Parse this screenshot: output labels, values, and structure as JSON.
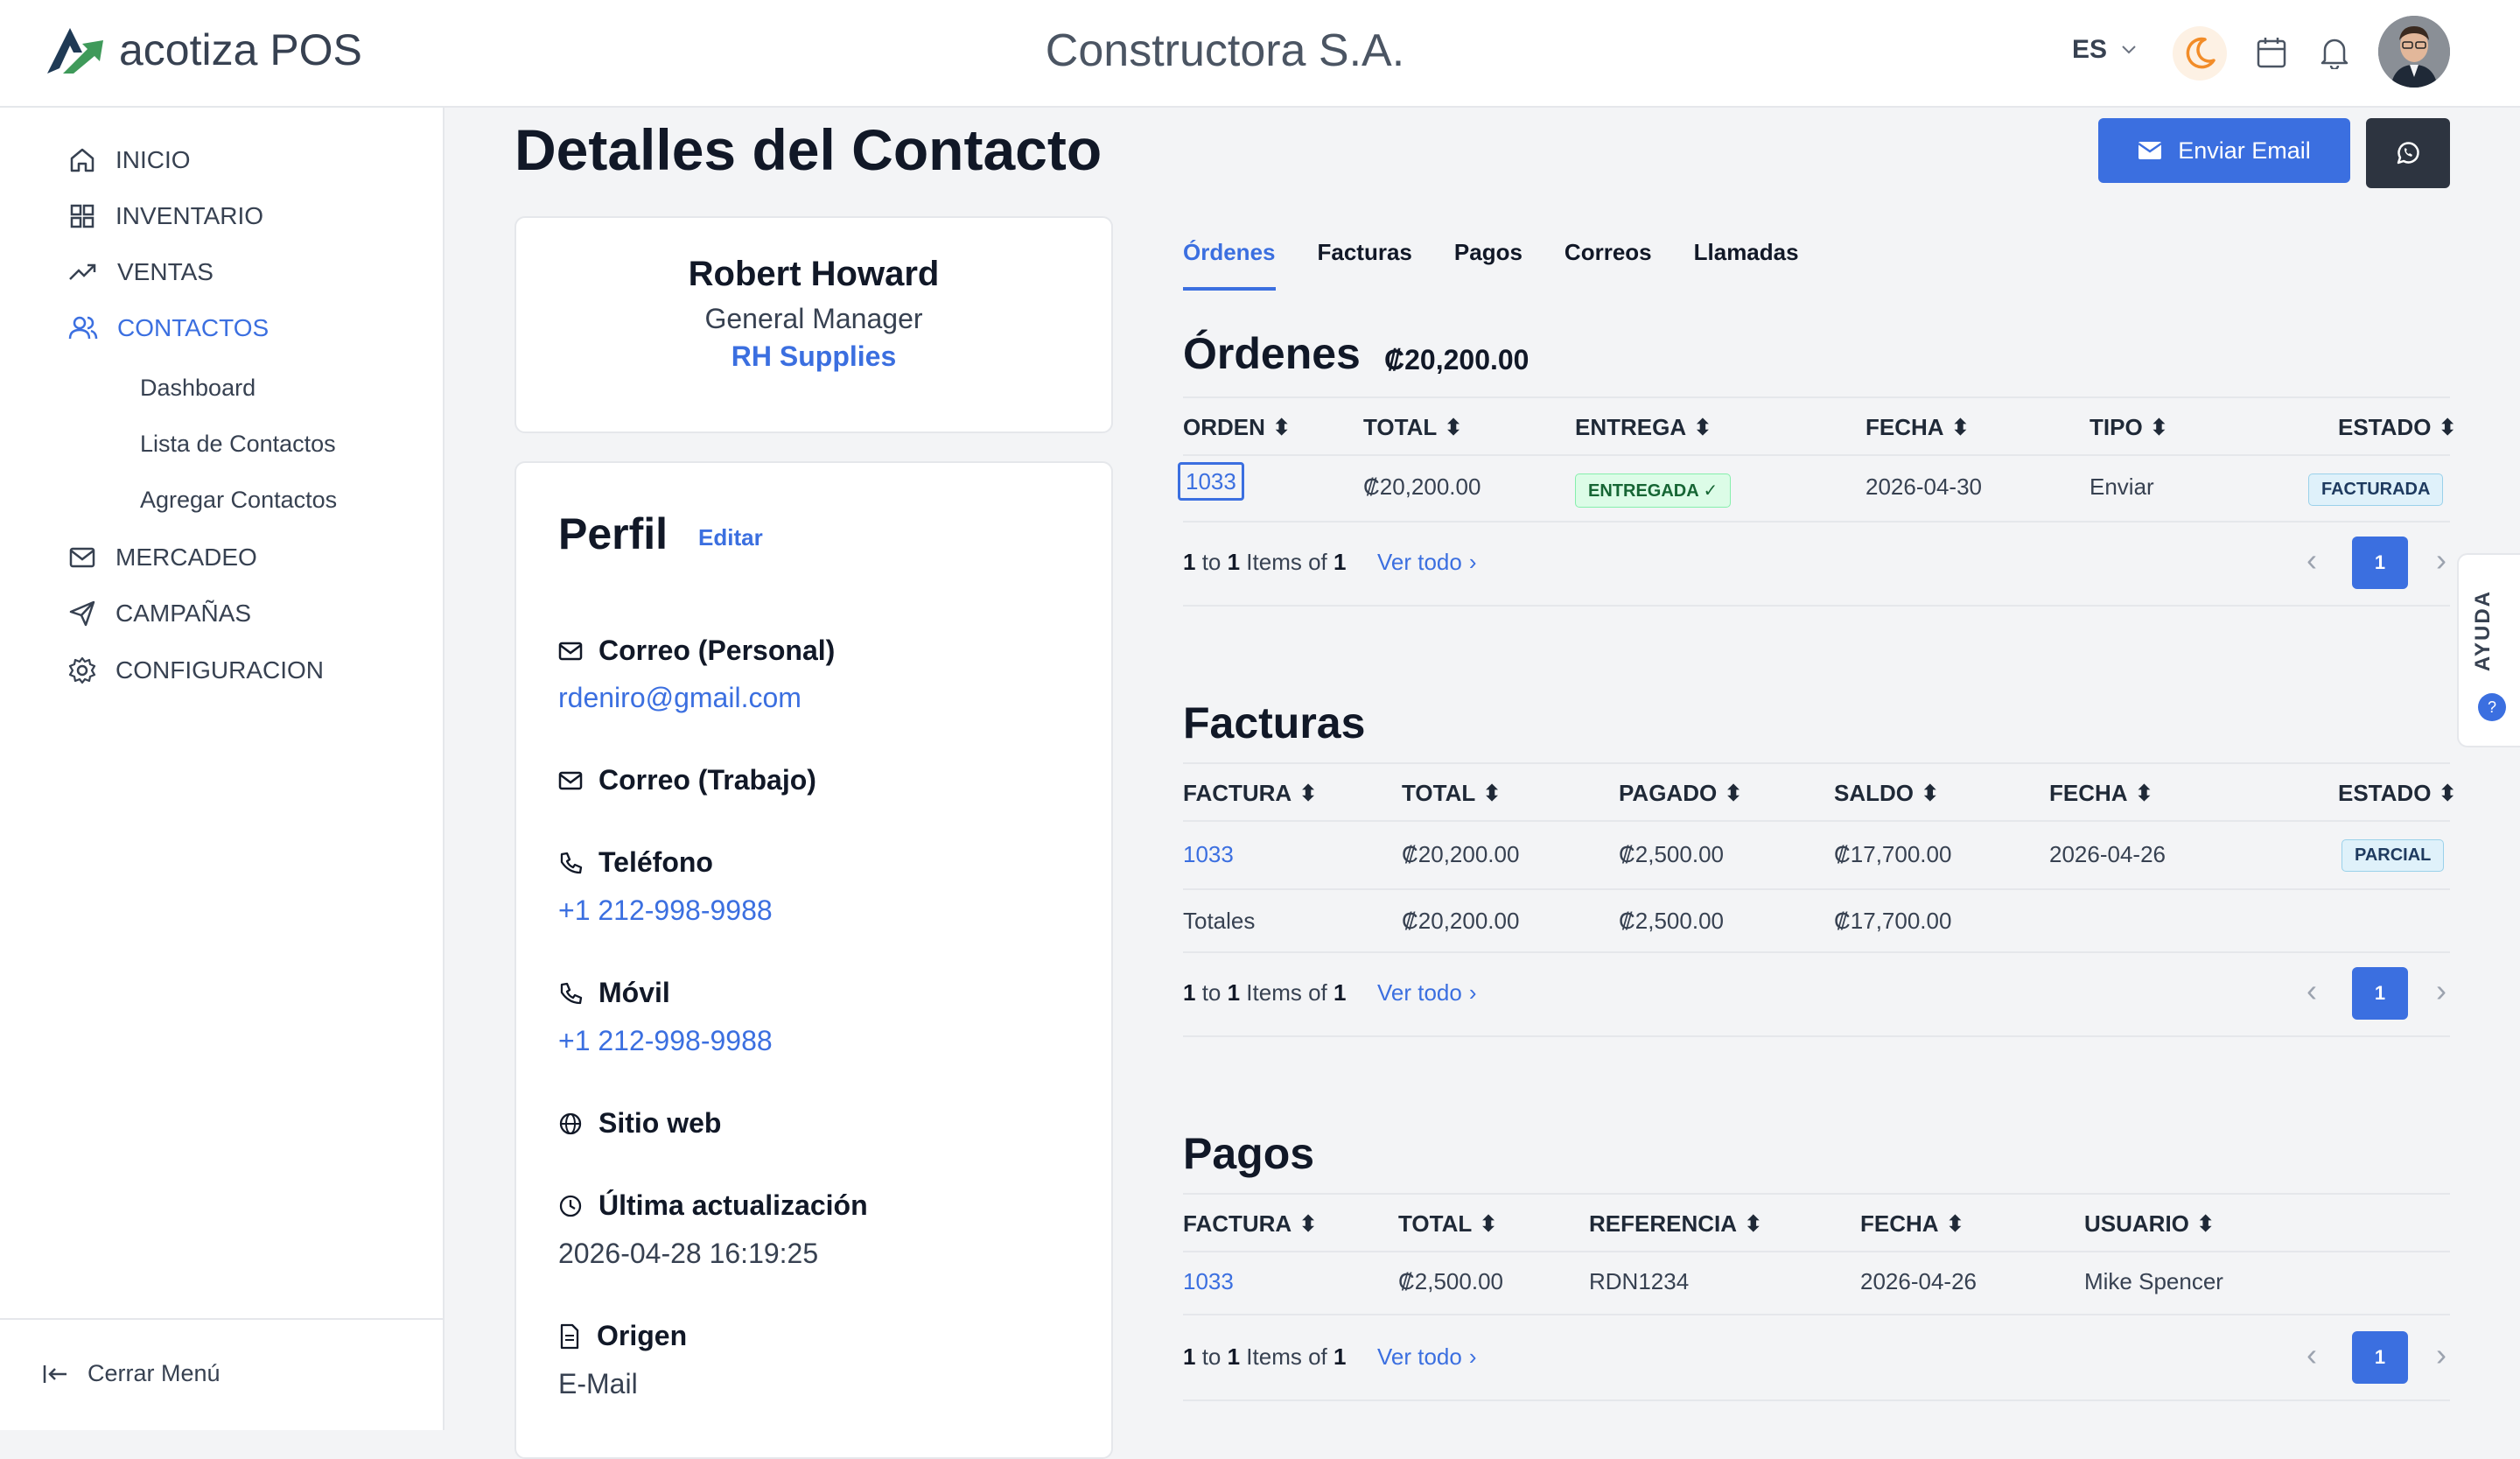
{
  "header": {
    "app_name": "acotiza POS",
    "company": "Constructora S.A.",
    "language": "ES",
    "colors": {
      "accent": "#3b6fe0",
      "moon": "#f28c28"
    }
  },
  "sidebar": {
    "items": [
      {
        "label": "INICIO",
        "icon": "home-icon"
      },
      {
        "label": "INVENTARIO",
        "icon": "grid-icon"
      },
      {
        "label": "VENTAS",
        "icon": "trend-up-icon"
      },
      {
        "label": "CONTACTOS",
        "icon": "users-icon"
      },
      {
        "label": "MERCADEO",
        "icon": "mail-icon"
      },
      {
        "label": "CAMPAÑAS",
        "icon": "send-icon"
      },
      {
        "label": "CONFIGURACION",
        "icon": "gear-icon"
      }
    ],
    "sub_items": [
      {
        "label": "Dashboard"
      },
      {
        "label": "Lista de Contactos"
      },
      {
        "label": "Agregar Contactos"
      }
    ],
    "close_menu": "Cerrar Menú"
  },
  "page": {
    "title": "Detalles del Contacto",
    "email_button": "Enviar Email"
  },
  "contact": {
    "name": "Robert Howard",
    "role": "General Manager",
    "company": "RH Supplies"
  },
  "profile": {
    "title": "Perfil",
    "edit": "Editar",
    "fields": [
      {
        "label": "Correo (Personal)",
        "value": "rdeniro@gmail.com"
      },
      {
        "label": "Correo (Trabajo)",
        "value": ""
      },
      {
        "label": "Teléfono",
        "value": "+1 212-998-9988"
      },
      {
        "label": "Móvil",
        "value": "+1 212-998-9988"
      },
      {
        "label": "Sitio web",
        "value": ""
      },
      {
        "label": "Última actualización",
        "value": "2026-04-28 16:19:25"
      },
      {
        "label": "Origen",
        "value": "E-Mail"
      }
    ]
  },
  "tabs": [
    "Órdenes",
    "Facturas",
    "Pagos",
    "Correos",
    "Llamadas"
  ],
  "ordenes": {
    "title": "Órdenes",
    "total": "₡20,200.00",
    "headers": [
      "ORDEN",
      "TOTAL",
      "ENTREGA",
      "FECHA",
      "TIPO",
      "ESTADO"
    ],
    "rows": [
      {
        "orden": "1033",
        "total": "₡20,200.00",
        "entrega": "ENTREGADA ✓",
        "fecha": "2026-04-30",
        "tipo": "Enviar",
        "estado": "FACTURADA"
      }
    ],
    "pager": {
      "from": "1",
      "to": "1",
      "middle": " to ",
      "items_of": " Items of ",
      "count": "1",
      "ver_todo": "Ver todo",
      "page": "1"
    }
  },
  "facturas": {
    "title": "Facturas",
    "headers": [
      "FACTURA",
      "TOTAL",
      "PAGADO",
      "SALDO",
      "FECHA",
      "ESTADO"
    ],
    "rows": [
      {
        "factura": "1033",
        "total": "₡20,200.00",
        "pagado": "₡2,500.00",
        "saldo": "₡17,700.00",
        "fecha": "2026-04-26",
        "estado": "PARCIAL"
      }
    ],
    "totals": {
      "label": "Totales",
      "total": "₡20,200.00",
      "pagado": "₡2,500.00",
      "saldo": "₡17,700.00"
    },
    "pager": {
      "from": "1",
      "to": "1",
      "middle": " to ",
      "items_of": " Items of ",
      "count": "1",
      "ver_todo": "Ver todo",
      "page": "1"
    }
  },
  "pagos": {
    "title": "Pagos",
    "headers": [
      "FACTURA",
      "TOTAL",
      "REFERENCIA",
      "FECHA",
      "USUARIO"
    ],
    "rows": [
      {
        "factura": "1033",
        "total": "₡2,500.00",
        "referencia": "RDN1234",
        "fecha": "2026-04-26",
        "usuario": "Mike Spencer"
      }
    ],
    "pager": {
      "from": "1",
      "to": "1",
      "middle": " to ",
      "items_of": " Items of ",
      "count": "1",
      "ver_todo": "Ver todo",
      "page": "1"
    }
  },
  "help": {
    "label": "AYUDA"
  }
}
